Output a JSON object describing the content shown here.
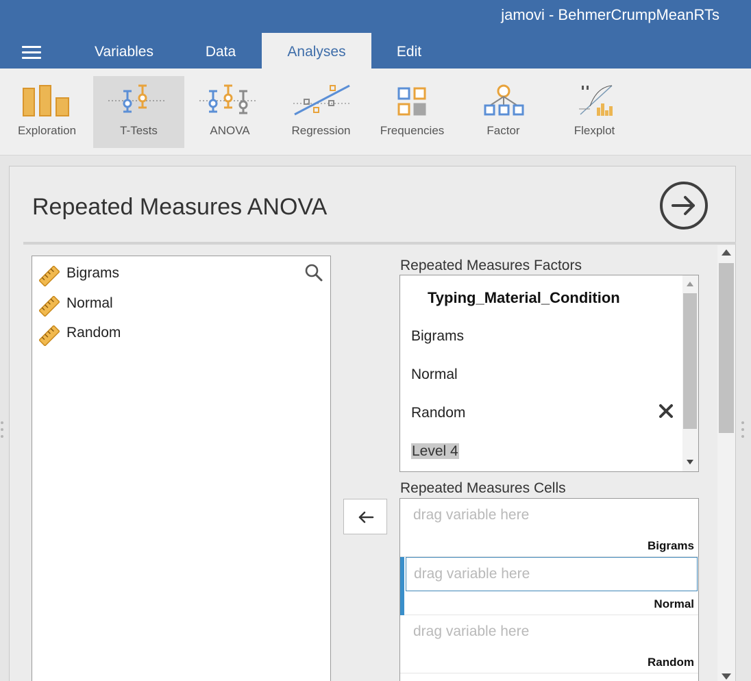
{
  "app": {
    "title": "jamovi - BehmerCrumpMeanRTs"
  },
  "menu": {
    "tabs": [
      {
        "label": "Variables",
        "active": false
      },
      {
        "label": "Data",
        "active": false
      },
      {
        "label": "Analyses",
        "active": true
      },
      {
        "label": "Edit",
        "active": false
      }
    ]
  },
  "ribbon": {
    "buttons": [
      {
        "label": "Exploration",
        "icon": "bar-chart-icon"
      },
      {
        "label": "T-Tests",
        "icon": "ttest-icon",
        "active": true
      },
      {
        "label": "ANOVA",
        "icon": "anova-icon"
      },
      {
        "label": "Regression",
        "icon": "regression-icon"
      },
      {
        "label": "Frequencies",
        "icon": "frequencies-icon"
      },
      {
        "label": "Factor",
        "icon": "factor-icon"
      },
      {
        "label": "Flexplot",
        "icon": "flexplot-icon"
      }
    ]
  },
  "panel": {
    "title": "Repeated Measures ANOVA",
    "variables": [
      {
        "name": "Bigrams",
        "icon": "ruler-icon"
      },
      {
        "name": "Normal",
        "icon": "ruler-icon"
      },
      {
        "name": "Random",
        "icon": "ruler-icon"
      }
    ],
    "factors": {
      "label": "Repeated Measures Factors",
      "factor_name": "Typing_Material_Condition",
      "levels": [
        "Bigrams",
        "Normal",
        "Random"
      ],
      "new_level_placeholder": "Level 4"
    },
    "cells": {
      "label": "Repeated Measures Cells",
      "items": [
        {
          "placeholder": "drag variable here",
          "label": "Bigrams",
          "selected": false
        },
        {
          "placeholder": "drag variable here",
          "label": "Normal",
          "selected": true
        },
        {
          "placeholder": "drag variable here",
          "label": "Random",
          "selected": false
        }
      ]
    }
  },
  "colors": {
    "header_bg": "#3e6da9",
    "accent_orange": "#e8a33c",
    "accent_blue": "#5b8fd6",
    "selection_blue": "#3a8fca"
  }
}
